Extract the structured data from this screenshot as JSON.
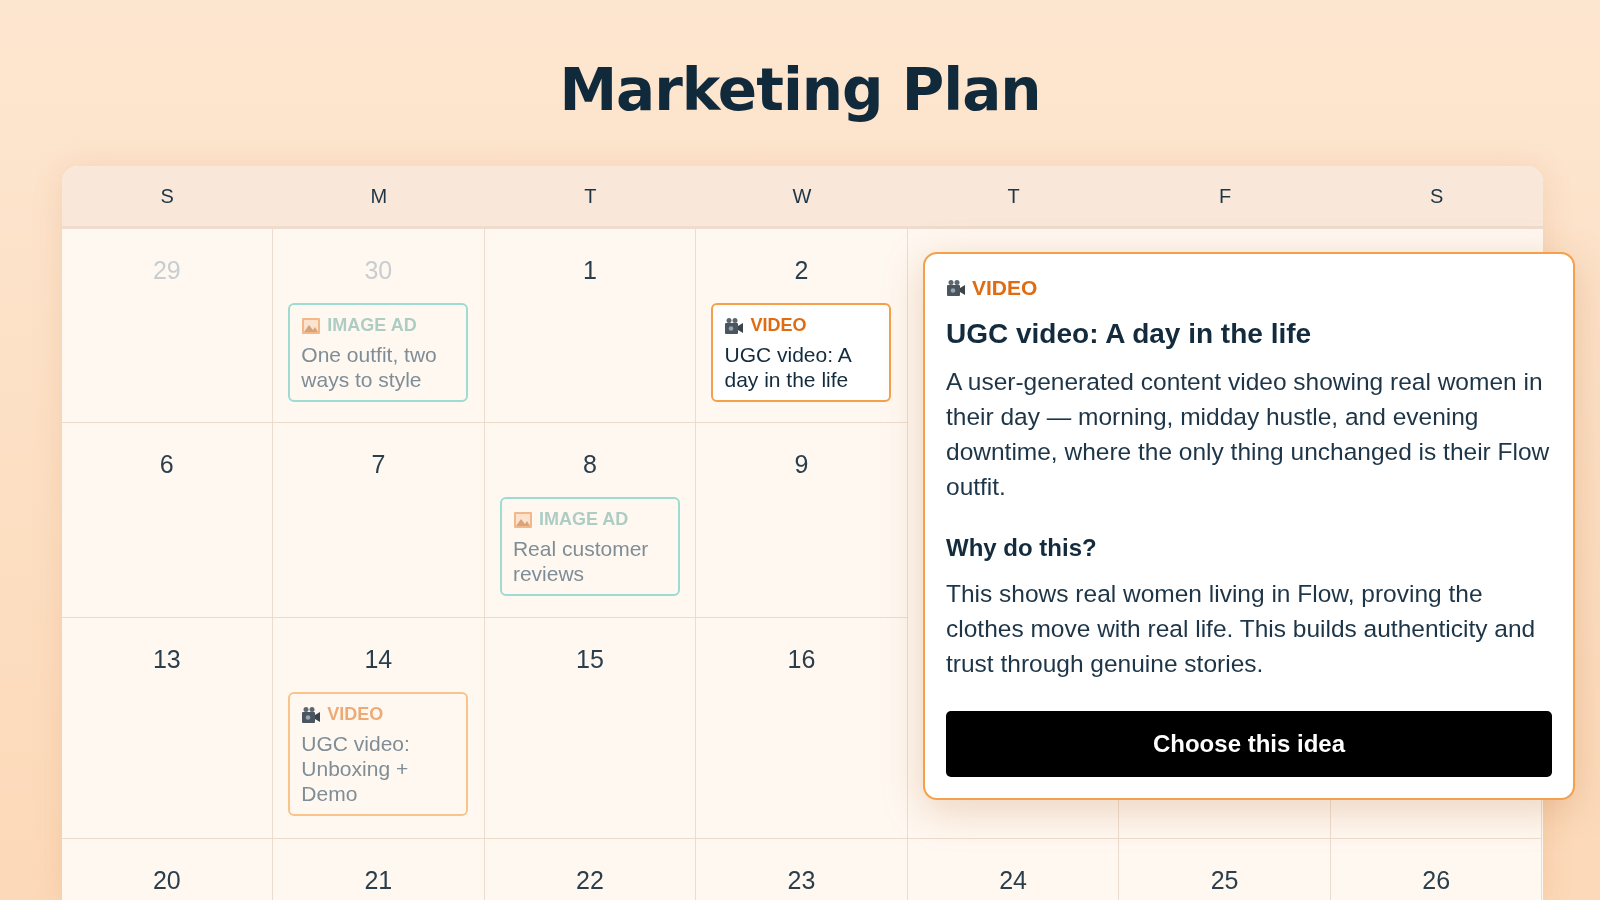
{
  "title": "Marketing Plan",
  "weekdays": [
    "S",
    "M",
    "T",
    "W",
    "T",
    "F",
    "S"
  ],
  "weeks": [
    {
      "cells": [
        {
          "day": "29",
          "muted": true
        },
        {
          "day": "30",
          "muted": true,
          "events": [
            {
              "kind": "image_ad",
              "label": "IMAGE AD",
              "text": "One outfit, two ways to style",
              "selected": false
            }
          ]
        },
        {
          "day": "1",
          "muted": false
        },
        {
          "day": "2",
          "muted": false,
          "events": [
            {
              "kind": "video",
              "label": "VIDEO",
              "text": "UGC video: A day in the life",
              "selected": true
            }
          ]
        }
      ]
    },
    {
      "cells": [
        {
          "day": "6",
          "muted": false
        },
        {
          "day": "7",
          "muted": false
        },
        {
          "day": "8",
          "muted": false,
          "events": [
            {
              "kind": "image_ad",
              "label": "IMAGE AD",
              "text": "Real customer reviews",
              "selected": false
            }
          ]
        },
        {
          "day": "9",
          "muted": false
        }
      ]
    },
    {
      "cells": [
        {
          "day": "13",
          "muted": false
        },
        {
          "day": "14",
          "muted": false,
          "events": [
            {
              "kind": "video",
              "label": "VIDEO",
              "text": "UGC video: Unboxing + Demo",
              "selected": false
            }
          ]
        },
        {
          "day": "15",
          "muted": false
        },
        {
          "day": "16",
          "muted": false
        },
        {},
        {},
        {}
      ]
    },
    {
      "cells": [
        {
          "day": "20",
          "muted": false
        },
        {
          "day": "21",
          "muted": false
        },
        {
          "day": "22",
          "muted": false
        },
        {
          "day": "23",
          "muted": false
        },
        {
          "day": "24",
          "muted": false
        },
        {
          "day": "25",
          "muted": false
        },
        {
          "day": "26",
          "muted": false
        }
      ]
    }
  ],
  "popup": {
    "kind": "video",
    "label": "VIDEO",
    "title": "UGC video: A day in the life",
    "description": "A user-generated content video showing real women in their day — morning, midday hustle, and evening downtime, where the only thing unchanged is their Flow outfit.",
    "why_heading": "Why do this?",
    "why_text": "This shows real women living in Flow, proving the clothes move with real life. This builds authenticity and trust through genuine stories.",
    "button": "Choose this idea"
  }
}
